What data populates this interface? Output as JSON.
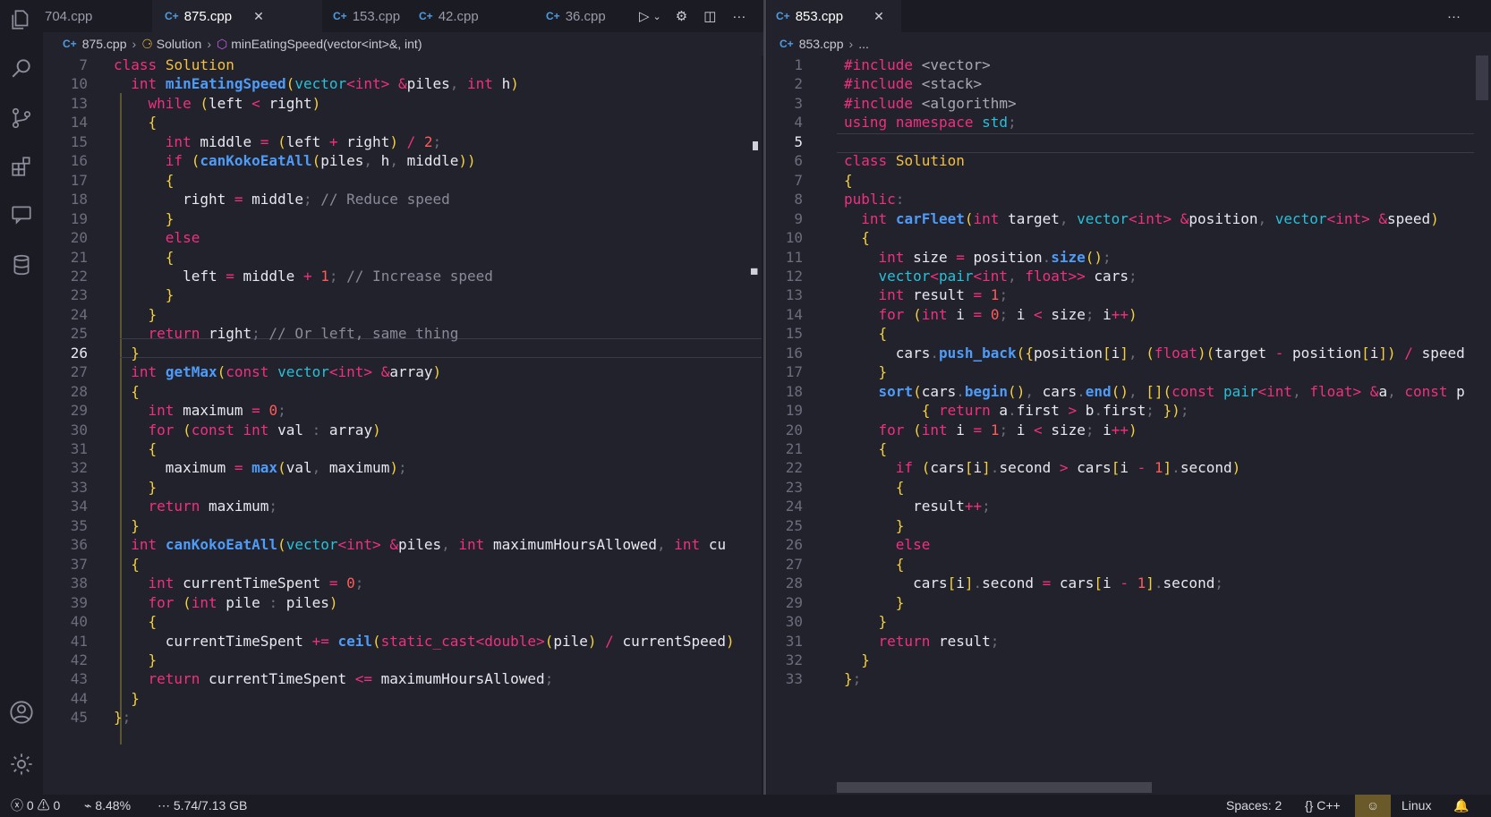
{
  "left_tabs": [
    "704.cpp",
    "875.cpp",
    "153.cpp",
    "42.cpp",
    "36.cpp"
  ],
  "right_tabs": [
    "853.cpp"
  ],
  "left_breadcrumb": {
    "file": "875.cpp",
    "class": "Solution",
    "method": "minEatingSpeed(vector<int>&, int)"
  },
  "right_breadcrumb": {
    "file": "853.cpp",
    "more": "..."
  },
  "status": {
    "errors": "0",
    "warnings": "0",
    "cpu": "8.48%",
    "memory": "5.74/7.13 GB",
    "spaces": "Spaces: 2",
    "language": "C++",
    "os": "Linux"
  },
  "colors": {
    "background": "#22222c",
    "keyword": "#f0307f",
    "type": "#28c0d8",
    "function": "#4e9cf8",
    "class": "#f4c040",
    "param": "#a6e22e"
  },
  "left_code": [
    {
      "n": "7",
      "t": "class Solution"
    },
    {
      "n": "10",
      "t": "  int minEatingSpeed(vector<int> &piles, int h)"
    },
    {
      "n": "13",
      "t": "    while (left < right)"
    },
    {
      "n": "14",
      "t": "    {"
    },
    {
      "n": "15",
      "t": "      int middle = (left + right) / 2;"
    },
    {
      "n": "16",
      "t": "      if (canKokoEatAll(piles, h, middle))"
    },
    {
      "n": "17",
      "t": "      {"
    },
    {
      "n": "18",
      "t": "        right = middle; // Reduce speed"
    },
    {
      "n": "19",
      "t": "      }"
    },
    {
      "n": "20",
      "t": "      else"
    },
    {
      "n": "21",
      "t": "      {"
    },
    {
      "n": "22",
      "t": "        left = middle + 1; // Increase speed"
    },
    {
      "n": "23",
      "t": "      }"
    },
    {
      "n": "24",
      "t": "    }"
    },
    {
      "n": "25",
      "t": "    return right; // Or left, same thing"
    },
    {
      "n": "26",
      "t": "  }"
    },
    {
      "n": "27",
      "t": "  int getMax(const vector<int> &array)"
    },
    {
      "n": "28",
      "t": "  {"
    },
    {
      "n": "29",
      "t": "    int maximum = 0;"
    },
    {
      "n": "30",
      "t": "    for (const int val : array)"
    },
    {
      "n": "31",
      "t": "    {"
    },
    {
      "n": "32",
      "t": "      maximum = max(val, maximum);"
    },
    {
      "n": "33",
      "t": "    }"
    },
    {
      "n": "34",
      "t": "    return maximum;"
    },
    {
      "n": "35",
      "t": "  }"
    },
    {
      "n": "36",
      "t": "  int canKokoEatAll(vector<int> &piles, int maximumHoursAllowed, int cu"
    },
    {
      "n": "37",
      "t": "  {"
    },
    {
      "n": "38",
      "t": "    int currentTimeSpent = 0;"
    },
    {
      "n": "39",
      "t": "    for (int pile : piles)"
    },
    {
      "n": "40",
      "t": "    {"
    },
    {
      "n": "41",
      "t": "      currentTimeSpent += ceil(static_cast<double>(pile) / currentSpeed)"
    },
    {
      "n": "42",
      "t": "    }"
    },
    {
      "n": "43",
      "t": "    return currentTimeSpent <= maximumHoursAllowed;"
    },
    {
      "n": "44",
      "t": "  }"
    },
    {
      "n": "45",
      "t": "};"
    }
  ],
  "right_code": [
    {
      "n": "1",
      "t": "#include <vector>"
    },
    {
      "n": "2",
      "t": "#include <stack>"
    },
    {
      "n": "3",
      "t": "#include <algorithm>"
    },
    {
      "n": "4",
      "t": "using namespace std;"
    },
    {
      "n": "5",
      "t": ""
    },
    {
      "n": "6",
      "t": "class Solution"
    },
    {
      "n": "7",
      "t": "{"
    },
    {
      "n": "8",
      "t": "public:"
    },
    {
      "n": "9",
      "t": "  int carFleet(int target, vector<int> &position, vector<int> &speed)"
    },
    {
      "n": "10",
      "t": "  {"
    },
    {
      "n": "11",
      "t": "    int size = position.size();"
    },
    {
      "n": "12",
      "t": "    vector<pair<int, float>> cars;"
    },
    {
      "n": "13",
      "t": "    int result = 1;"
    },
    {
      "n": "14",
      "t": "    for (int i = 0; i < size; i++)"
    },
    {
      "n": "15",
      "t": "    {"
    },
    {
      "n": "16",
      "t": "      cars.push_back({position[i], (float)(target - position[i]) / speed"
    },
    {
      "n": "17",
      "t": "    }"
    },
    {
      "n": "18",
      "t": "    sort(cars.begin(), cars.end(), [](const pair<int, float> &a, const p"
    },
    {
      "n": "19",
      "t": "         { return a.first > b.first; });"
    },
    {
      "n": "20",
      "t": "    for (int i = 1; i < size; i++)"
    },
    {
      "n": "21",
      "t": "    {"
    },
    {
      "n": "22",
      "t": "      if (cars[i].second > cars[i - 1].second)"
    },
    {
      "n": "23",
      "t": "      {"
    },
    {
      "n": "24",
      "t": "        result++;"
    },
    {
      "n": "25",
      "t": "      }"
    },
    {
      "n": "26",
      "t": "      else"
    },
    {
      "n": "27",
      "t": "      {"
    },
    {
      "n": "28",
      "t": "        cars[i].second = cars[i - 1].second;"
    },
    {
      "n": "29",
      "t": "      }"
    },
    {
      "n": "30",
      "t": "    }"
    },
    {
      "n": "31",
      "t": "    return result;"
    },
    {
      "n": "32",
      "t": "  }"
    },
    {
      "n": "33",
      "t": "};"
    }
  ]
}
